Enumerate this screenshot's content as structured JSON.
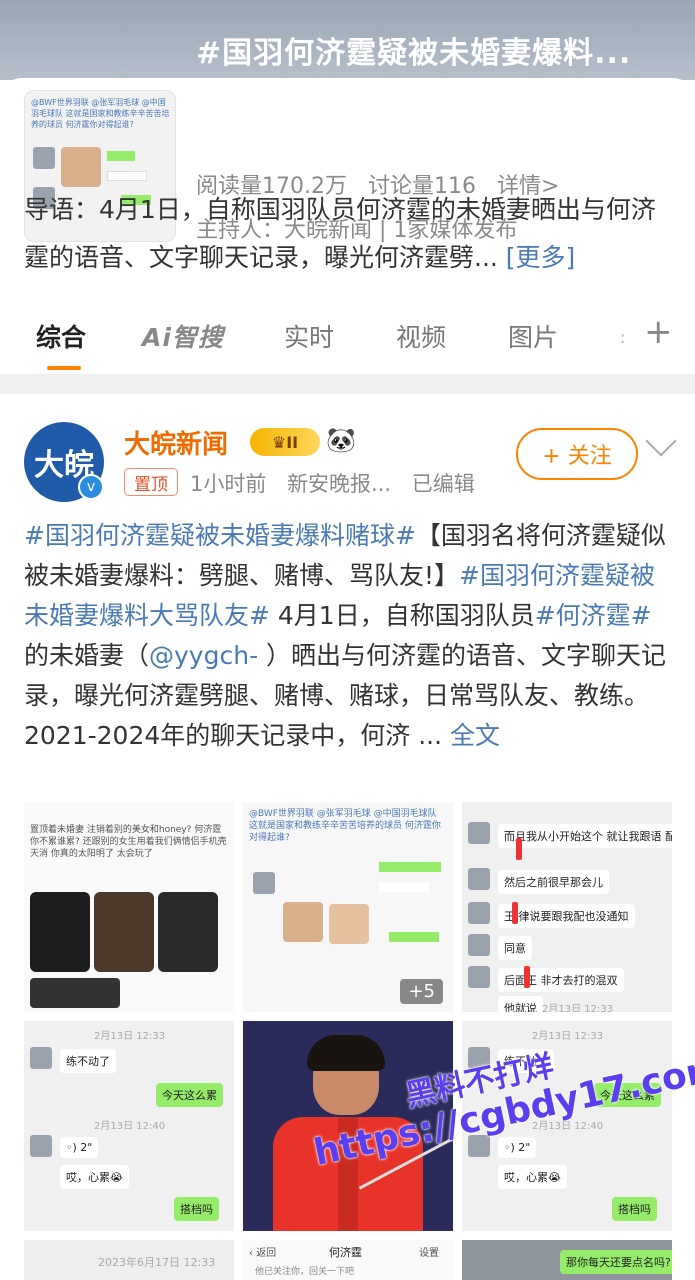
{
  "topic": {
    "title": "#国羽何济霆疑被未婚妻爆料...",
    "stats": [
      "阅读量170.2万",
      "讨论量116",
      "详情>"
    ],
    "host": "主持人：大皖新闻 | 1家媒体发布",
    "intro_text": "导语：4月1日，自称国羽队员何济霆的未婚妻晒出与何济霆的语音、文字聊天记录，曝光何济霆劈...",
    "intro_more": "[更多]",
    "thumb_text": "@BWF世界羽联 @张军羽毛球 @中国羽毛球队 这就是国家和教练辛辛苦苦培养的球员 何济霆你对得起谁?"
  },
  "tabs": {
    "items": [
      "综合",
      "Ai智搜",
      "实时",
      "视频",
      "图片"
    ],
    "active": "综合",
    "plus": "+"
  },
  "post": {
    "author": "大皖新闻",
    "avatar_text": "大皖",
    "level_badge": "II",
    "follow_label": "+ 关注",
    "pin_label": "置顶",
    "meta": [
      "1小时前",
      "新安晚报...",
      "已编辑"
    ],
    "text": {
      "tag1": "#国羽何济霆疑被未婚妻爆料赌球#",
      "t1": "【国羽名将何济霆疑似被未婚妻爆料：劈腿、赌博、骂队友!】",
      "tag2": "#国羽何济霆疑被未婚妻爆料大骂队友#",
      "t2": " 4月1日，自称国羽队员",
      "tag3": "#何济霆#",
      "t3": "的未婚妻（",
      "at": "@yygch-",
      "t4": " ）晒出与何济霆的语音、文字聊天记录，曝光何济霆劈腿、赌博、赌球，日常骂队友、教练。 2021-2024年的聊天记录中，何济 ... ",
      "fulltext": "全文"
    },
    "images": {
      "c1_text": "置顶着未婚妻 注销着别的美女和honey? 何济霆你不累谁累? 还跟别的女生用着我们俩情侣手机壳 天消 你真的太阳明了 太会玩了",
      "c2_text": "@BWF世界羽联 @张军羽毛球 @中国羽毛球队 这就是国家和教练辛辛苦苦培养的球员 何济霆你对得起谁?",
      "c2_more": "+5",
      "c3_bubbles": [
        "而且我从小开始这个 就让我跟语 配",
        "然后之前很早那会儿",
        "王 律说要跟我配也没通知",
        "同意",
        "后面王 非才去打的混双",
        "他就说"
      ],
      "c3_time": "2月13日 12:33",
      "c4_time": "2月13日 12:33",
      "c4_bubbles": [
        "练不动了",
        "今天这么累",
        "2\"",
        "哎，心累😭",
        "搭档吗"
      ],
      "c4_time2": "2月13日 12:40",
      "c6_time": "2月13日 12:33",
      "c6_bubbles": [
        "练不动了",
        "今天这么累",
        "2\"",
        "哎，心累😭",
        "搭档吗"
      ],
      "c6_time2": "2月13日 12:40",
      "c7_time": "2023年6月17日 12:33",
      "c8_back": "返回",
      "c8_name": "何济霆",
      "c8_settings": "设置",
      "c8_line": "他已关注你，回关一下吧",
      "c9_text": "那你每天还要点名吗?"
    },
    "watermark": [
      "黑料不打烊",
      "https://cgbdy17.com"
    ]
  }
}
